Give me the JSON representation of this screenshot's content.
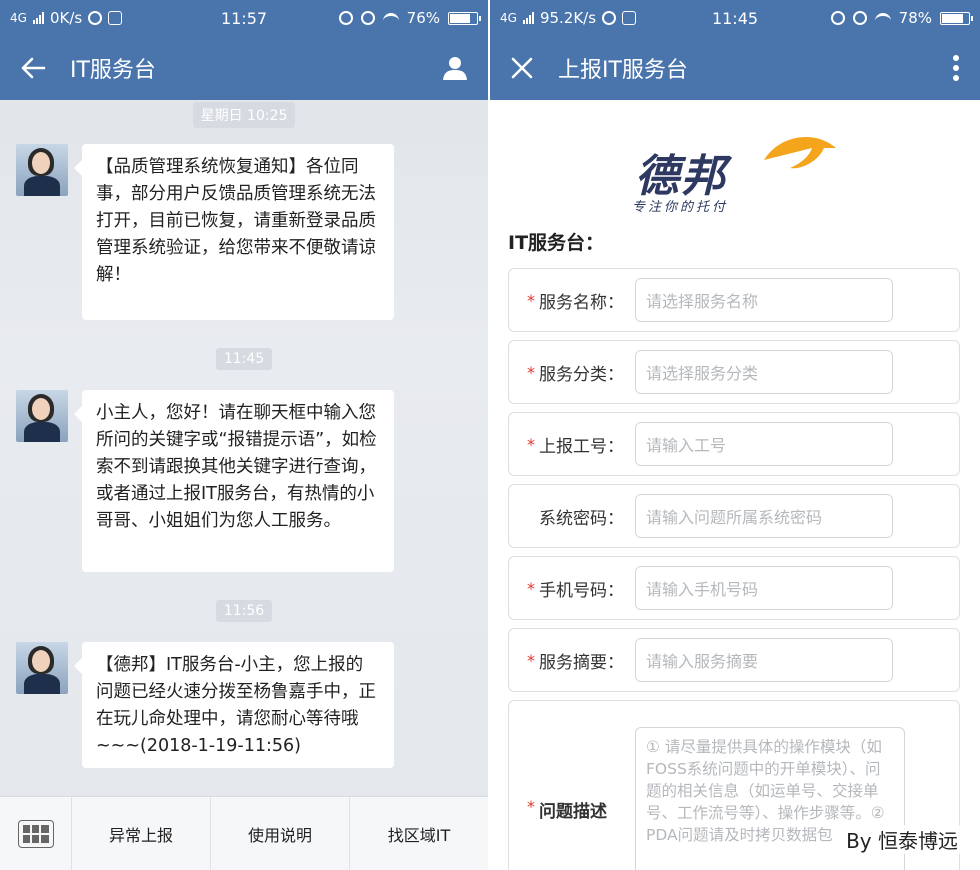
{
  "left": {
    "status": {
      "network": "4G",
      "speed": "0K/s",
      "time": "11:57",
      "battery": "76%",
      "battery_level": 0.76
    },
    "title": "IT服务台",
    "messages": [
      {
        "timestamp": "星期日 10:25",
        "text": "【品质管理系统恢复通知】各位同事，部分用户反馈品质管理系统无法打开，目前已恢复，请重新登录品质管理系统验证，给您带来不便敬请谅解！"
      },
      {
        "timestamp": "11:45",
        "text": "小主人，您好！请在聊天框中输入您所问的关键字或“报错提示语”，如检索不到请跟换其他关键字进行查询，或者通过上报IT服务台，有热情的小哥哥、小姐姐们为您人工服务。"
      },
      {
        "timestamp": "11:56",
        "text": "【德邦】IT服务台-小主，您上报的问题已经火速分拨至杨鲁嘉手中，正在玩儿命处理中，请您耐心等待哦~~~(2018-1-19-11:56)"
      }
    ],
    "menu": [
      "异常上报",
      "使用说明",
      "找区域IT"
    ]
  },
  "right": {
    "status": {
      "network": "4G",
      "speed": "95.2K/s",
      "time": "11:45",
      "battery": "78%",
      "battery_level": 0.78
    },
    "title": "上报IT服务台",
    "logo": {
      "brand": "德邦",
      "slogan": "专注你的托付"
    },
    "form_title": "IT服务台：",
    "fields": [
      {
        "required": "*",
        "label": "服务名称：",
        "placeholder": "请选择服务名称"
      },
      {
        "required": "*",
        "label": "服务分类：",
        "placeholder": "请选择服务分类"
      },
      {
        "required": "*",
        "label": "上报工号：",
        "placeholder": "请输入工号"
      },
      {
        "required": "",
        "label": "系统密码：",
        "placeholder": "请输入问题所属系统密码"
      },
      {
        "required": "*",
        "label": "手机号码：",
        "placeholder": "请输入手机号码"
      },
      {
        "required": "*",
        "label": "服务摘要：",
        "placeholder": "请输入服务摘要"
      },
      {
        "required": "*",
        "label": "问题描述",
        "placeholder": "① 请尽量提供具体的操作模块（如FOSS系统问题中的开单模块）、问题的相关信息（如运单号、交接单号、工作流号等）、操作步骤等。② PDA问题请及时拷贝数据包"
      }
    ],
    "watermark": "By 恒泰博远"
  }
}
